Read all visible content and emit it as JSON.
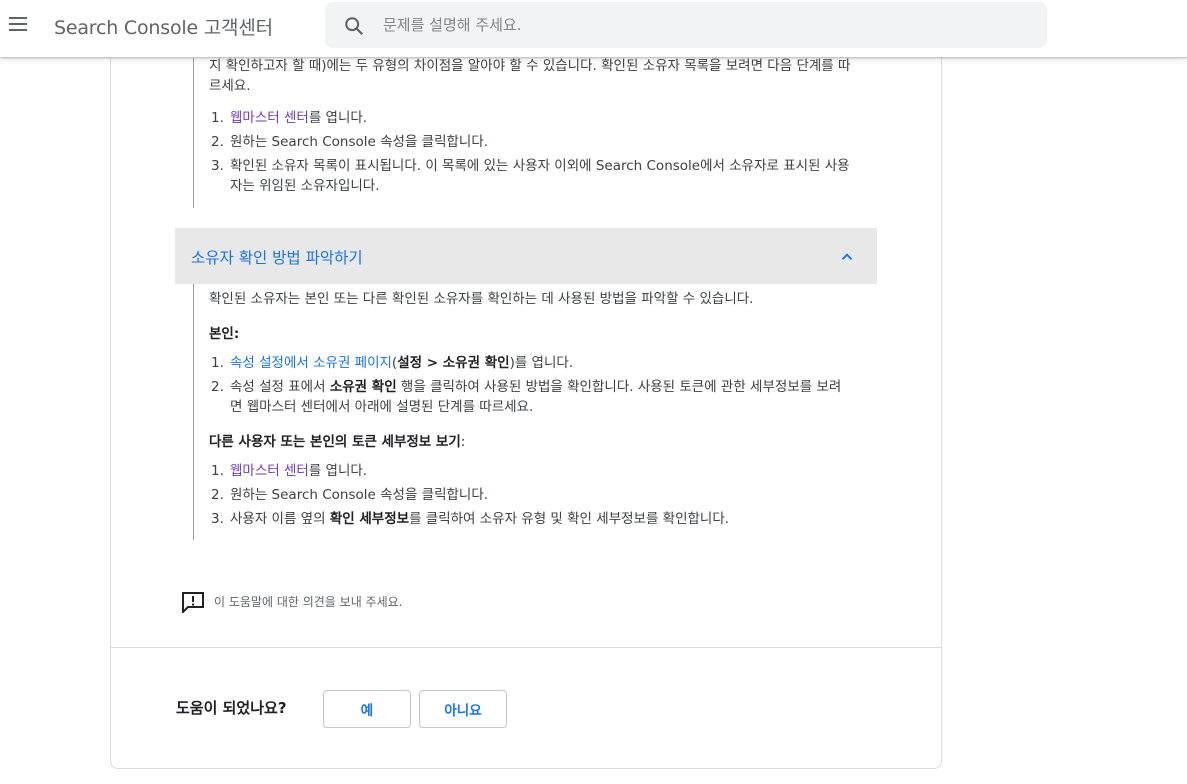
{
  "header": {
    "brand": "Search Console 고객센터",
    "search_placeholder": "문제를 설명해 주세요."
  },
  "section1": {
    "intro": "지 확인하고자 할 때)에는 두 유형의 차이점을 알아야 할 수 있습니다. 확인된 소유자 목록을 보려면 다음 단계를 따르세요.",
    "steps": [
      {
        "num": "1.",
        "link": "웹마스터 센터",
        "rest": "를 엽니다."
      },
      {
        "num": "2.",
        "text": "원하는 Search Console 속성을 클릭합니다."
      },
      {
        "num": "3.",
        "text": "확인된 소유자 목록이 표시됩니다. 이 목록에 있는 사용자 이외에 Search Console에서 소유자로 표시된 사용자는 위임된 소유자입니다."
      }
    ]
  },
  "accordion": {
    "title": "소유자 확인 방법 파악하기",
    "intro": "확인된 소유자는 본인 또는 다른 확인된 소유자를 확인하는 데 사용된 방법을 파악할 수 있습니다.",
    "self_heading": "본인:",
    "self_steps": {
      "s1_num": "1.",
      "s1_link": "속성 설정에서 소유권 페이지",
      "s1_open": "(",
      "s1_bold": "설정 > 소유권 확인",
      "s1_close": ")를 엽니다.",
      "s2_num": "2.",
      "s2_pre": "속성 설정 표에서 ",
      "s2_bold": "소유권 확인",
      "s2_post": " 행을 클릭하여 사용된 방법을 확인합니다. 사용된 토큰에 관한 세부정보를 보려면 웹마스터 센터에서 아래에 설명된 단계를 따르세요."
    },
    "other_heading": "다른 사용자 또는 본인의 토큰 세부정보 보기",
    "other_heading_colon": ":",
    "other_steps": {
      "s1_num": "1.",
      "s1_link": "웹마스터 센터",
      "s1_rest": "를 엽니다.",
      "s2_num": "2.",
      "s2_text": "원하는 Search Console 속성을 클릭합니다.",
      "s3_num": "3.",
      "s3_pre": "사용자 이름 옆의 ",
      "s3_bold": "확인 세부정보",
      "s3_post": "를 클릭하여 소유자 유형 및 확인 세부정보를 확인합니다."
    }
  },
  "feedback": {
    "text": "이 도움말에 대한 의견을 보내 주세요."
  },
  "helpful": {
    "question": "도움이 되었나요?",
    "yes": "예",
    "no": "아니요"
  }
}
